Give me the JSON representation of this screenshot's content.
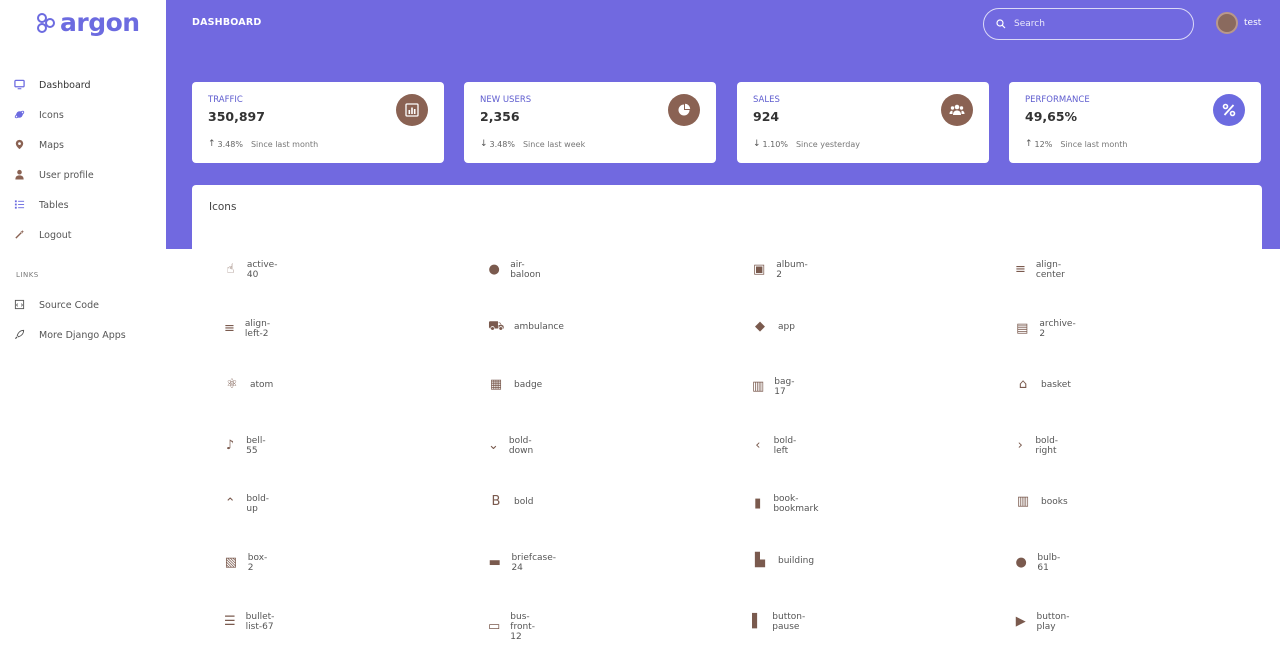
{
  "brand": {
    "name": "argon"
  },
  "sidebar": {
    "items": [
      {
        "label": "Dashboard",
        "icon": "monitor-icon"
      },
      {
        "label": "Icons",
        "icon": "planet-icon"
      },
      {
        "label": "Maps",
        "icon": "pin-icon"
      },
      {
        "label": "User profile",
        "icon": "user-icon"
      },
      {
        "label": "Tables",
        "icon": "list-icon"
      },
      {
        "label": "Logout",
        "icon": "magic-icon"
      }
    ],
    "links_title": "LINKS",
    "links": [
      {
        "label": "Source Code",
        "icon": "code-icon"
      },
      {
        "label": "More Django Apps",
        "icon": "rocket-icon"
      }
    ]
  },
  "header": {
    "title": "DASHBOARD",
    "search_placeholder": "Search",
    "user_name": "test",
    "accent": "#7169e0"
  },
  "stats": [
    {
      "title": "TRAFFIC",
      "value": "350,897",
      "arrow": "↑",
      "delta": "3.48%",
      "since": "Since last month",
      "icon": "chart-bar-icon"
    },
    {
      "title": "NEW USERS",
      "value": "2,356",
      "arrow": "↓",
      "delta": "3.48%",
      "since": "Since last week",
      "icon": "chart-pie-icon"
    },
    {
      "title": "SALES",
      "value": "924",
      "arrow": "↓",
      "delta": "1.10%",
      "since": "Since yesterday",
      "icon": "users-icon"
    },
    {
      "title": "PERFORMANCE",
      "value": "49,65%",
      "arrow": "↑",
      "delta": "12%",
      "since": "Since last month",
      "icon": "percent-icon"
    }
  ],
  "icons_card": {
    "title": "Icons",
    "items": [
      {
        "name": "active-40",
        "glyph": "☝"
      },
      {
        "name": "air-baloon",
        "glyph": "●"
      },
      {
        "name": "album-2",
        "glyph": "▣"
      },
      {
        "name": "align-center",
        "glyph": "≡"
      },
      {
        "name": "align-left-2",
        "glyph": "≡"
      },
      {
        "name": "ambulance",
        "glyph": "⛟"
      },
      {
        "name": "app",
        "glyph": "◆"
      },
      {
        "name": "archive-2",
        "glyph": "▤"
      },
      {
        "name": "atom",
        "glyph": "⚛"
      },
      {
        "name": "badge",
        "glyph": "▦"
      },
      {
        "name": "bag-17",
        "glyph": "▥"
      },
      {
        "name": "basket",
        "glyph": "⌂"
      },
      {
        "name": "bell-55",
        "glyph": "♪"
      },
      {
        "name": "bold-down",
        "glyph": "⌄"
      },
      {
        "name": "bold-left",
        "glyph": "‹"
      },
      {
        "name": "bold-right",
        "glyph": "›"
      },
      {
        "name": "bold-up",
        "glyph": "⌃"
      },
      {
        "name": "bold",
        "glyph": "B"
      },
      {
        "name": "book-bookmark",
        "glyph": "▮"
      },
      {
        "name": "books",
        "glyph": "▥"
      },
      {
        "name": "box-2",
        "glyph": "▧"
      },
      {
        "name": "briefcase-24",
        "glyph": "▬"
      },
      {
        "name": "building",
        "glyph": "▙"
      },
      {
        "name": "bulb-61",
        "glyph": "●"
      },
      {
        "name": "bullet-list-67",
        "glyph": "☰"
      },
      {
        "name": "bus-front-12",
        "glyph": "▭"
      },
      {
        "name": "button-pause",
        "glyph": "▌"
      },
      {
        "name": "button-play",
        "glyph": "▶"
      }
    ]
  }
}
